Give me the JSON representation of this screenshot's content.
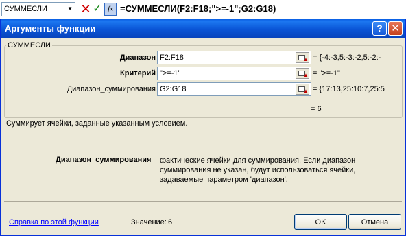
{
  "formula_bar": {
    "name_box": "СУММЕСЛИ",
    "formula": "=СУММЕСЛИ(F2:F18;\">=-1\";G2:G18)",
    "fx_label": "fx"
  },
  "dialog": {
    "title": "Аргументы функции",
    "help_button": "?",
    "close_button": "✕",
    "function_group": "СУММЕСЛИ",
    "args": [
      {
        "label": "Диапазон",
        "value": "F2:F18",
        "result": "= {-4:-3,5:-3:-2,5:-2:-"
      },
      {
        "label": "Критерий",
        "value": "\">=-1\"",
        "result": "= \">=-1\""
      },
      {
        "label": "Диапазон_суммирования",
        "value": "G2:G18",
        "result": "= {17:13,25:10:7,25:5"
      }
    ],
    "formula_result": "= 6",
    "description": "Суммирует ячейки, заданные указанным условием.",
    "param_name": "Диапазон_суммирования",
    "param_description": "фактические ячейки для суммирования. Если диапазон суммирования не указан, будут использоваться ячейки, задаваемые параметром 'диапазон'.",
    "help_link": "Справка по этой функции",
    "value_label": "Значение:",
    "value": "6",
    "ok_label": "OK",
    "cancel_label": "Отмена"
  },
  "colors": {
    "titlebar": "#0a55d6",
    "dialog_bg": "#ece9d8",
    "link": "#0000ff",
    "cancel_x": "#d00000",
    "enter_check": "#1a8a1a"
  },
  "icons": [
    "chevron-down-icon",
    "cancel-x-icon",
    "enter-check-icon",
    "fx-icon",
    "help-icon",
    "close-icon",
    "collapse-dialog-icon"
  ]
}
